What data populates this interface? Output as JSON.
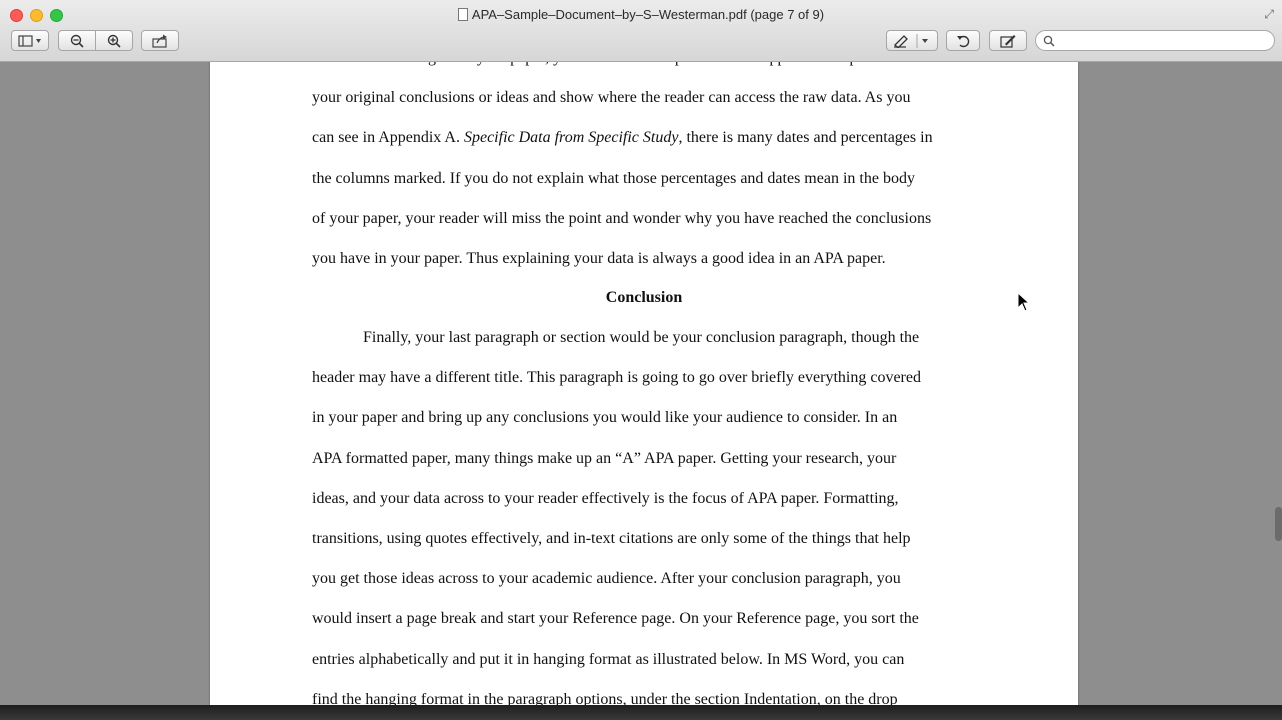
{
  "window": {
    "title": "APA–Sample–Document–by–S–Westerman.pdf (page 7 of 9)"
  },
  "toolbar": {
    "search_placeholder": "",
    "buttons": [
      "sidebar-toggle-icon",
      "zoom-out-icon",
      "zoom-in-icon",
      "share-icon",
      "annotate-icon",
      "rotate-icon",
      "edit-icon"
    ]
  },
  "document": {
    "lines": [
      {
        "segments": [
          {
            "text": "could use it as a figure in your paper, you still need to explain how it supports or disproves",
            "italic": false
          }
        ]
      },
      {
        "segments": [
          {
            "text": "your original conclusions or ideas and show where the reader can access the raw data.  As you",
            "italic": false
          }
        ]
      },
      {
        "segments": [
          {
            "text": "can see in Appendix A. ",
            "italic": false
          },
          {
            "text": "Specific Data from Specific Study",
            "italic": true
          },
          {
            "text": ", there is many dates and percentages in",
            "italic": false
          }
        ]
      },
      {
        "segments": [
          {
            "text": "the columns marked.  If you do not explain what those percentages and dates mean in the body",
            "italic": false
          }
        ]
      },
      {
        "segments": [
          {
            "text": "of your paper, your reader will miss the point and wonder why you have reached the conclusions",
            "italic": false
          }
        ]
      },
      {
        "segments": [
          {
            "text": "you have in your paper.  Thus explaining your data is always a good idea in an APA paper.",
            "italic": false
          }
        ]
      }
    ],
    "heading": "Conclusion",
    "paragraph_lines": [
      "Finally, your last paragraph or section would be your conclusion paragraph, though the",
      "header may have a different title.  This paragraph is going to go over briefly everything covered",
      "in your paper and bring up any conclusions you would like your audience to consider.  In an",
      "APA formatted paper, many things make up an “A” APA paper.  Getting your research, your",
      "ideas, and your data across to your reader effectively is the focus of APA paper.  Formatting,",
      "transitions, using quotes effectively, and in-text citations are only some of the things that help",
      "you get those ideas across to your academic audience.  After your conclusion paragraph, you",
      "would insert a page break and start your Reference page.  On your Reference page, you sort the",
      "entries alphabetically and put it in hanging format as illustrated below.  In MS Word, you can",
      "find the hanging format in the paragraph options, under the section Indentation, on the drop"
    ]
  }
}
